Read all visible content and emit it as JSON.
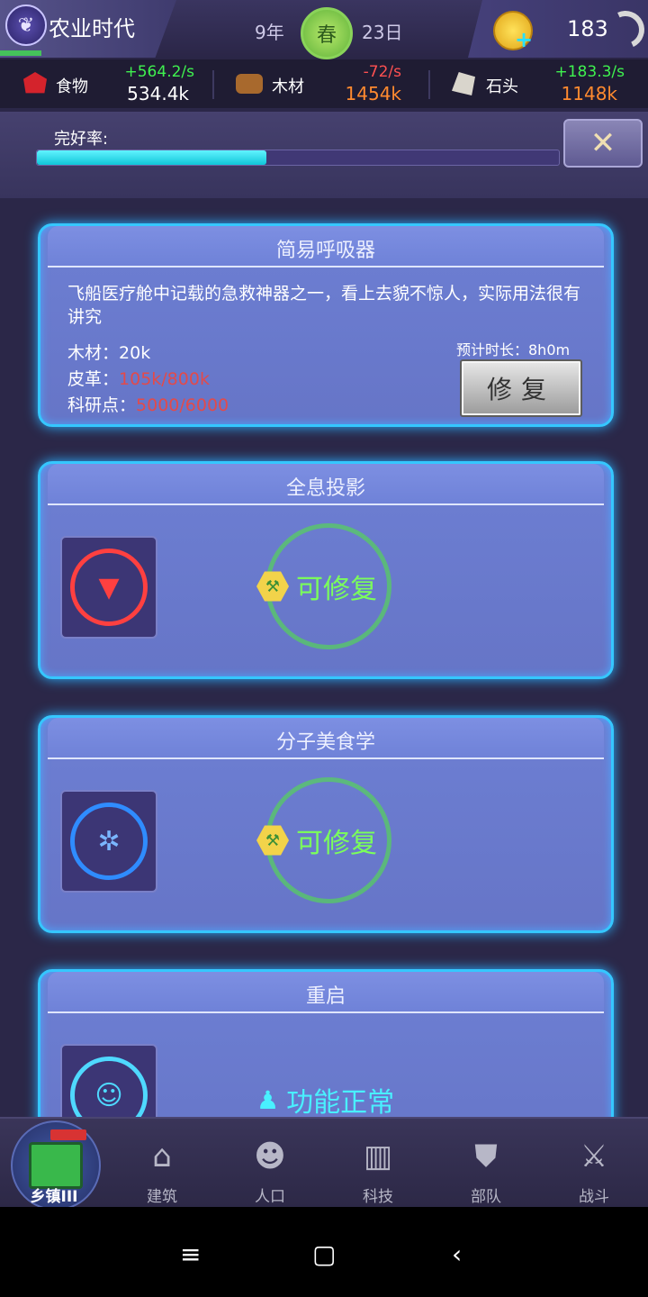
{
  "header": {
    "era_title": "农业时代",
    "year": "9年",
    "season": "春",
    "day": "23日",
    "coins": "183"
  },
  "resources": [
    {
      "label": "食物",
      "rate": "+564.2/s",
      "total": "534.4k",
      "rate_color": "#3ff24f",
      "total_color": "#ffffff"
    },
    {
      "label": "木材",
      "rate": "-72/s",
      "total": "1454k",
      "rate_color": "#ff5151",
      "total_color": "#ff8a2f"
    },
    {
      "label": "石头",
      "rate": "+183.3/s",
      "total": "1148k",
      "rate_color": "#3ff24f",
      "total_color": "#ff8a2f"
    }
  ],
  "integrity": {
    "label": "完好率:",
    "progress": 0.44
  },
  "cards": [
    {
      "title": "简易呼吸器",
      "description": "飞船医疗舱中记载的急救神器之一，看上去貌不惊人，实际用法很有讲究",
      "requirements": [
        {
          "label": "木材：",
          "value": "20k",
          "ok": true
        },
        {
          "label": "皮革：",
          "value": "105k/800k",
          "ok": false
        },
        {
          "label": "科研点：",
          "value": "5000/6000",
          "ok": false
        }
      ],
      "eta_label": "预计时长：8h0m",
      "button": "修复"
    },
    {
      "title": "全息投影",
      "status": "可修复",
      "icon": "paw-emblem-icon"
    },
    {
      "title": "分子美食学",
      "status": "可修复",
      "icon": "wheat-dna-icon"
    },
    {
      "title": "重启",
      "status": "功能正常",
      "icon": "robot-battery-icon"
    }
  ],
  "nav": [
    {
      "label": "乡镇III",
      "active": true
    },
    {
      "label": "建筑"
    },
    {
      "label": "人口"
    },
    {
      "label": "科技"
    },
    {
      "label": "部队"
    },
    {
      "label": "战斗"
    }
  ]
}
